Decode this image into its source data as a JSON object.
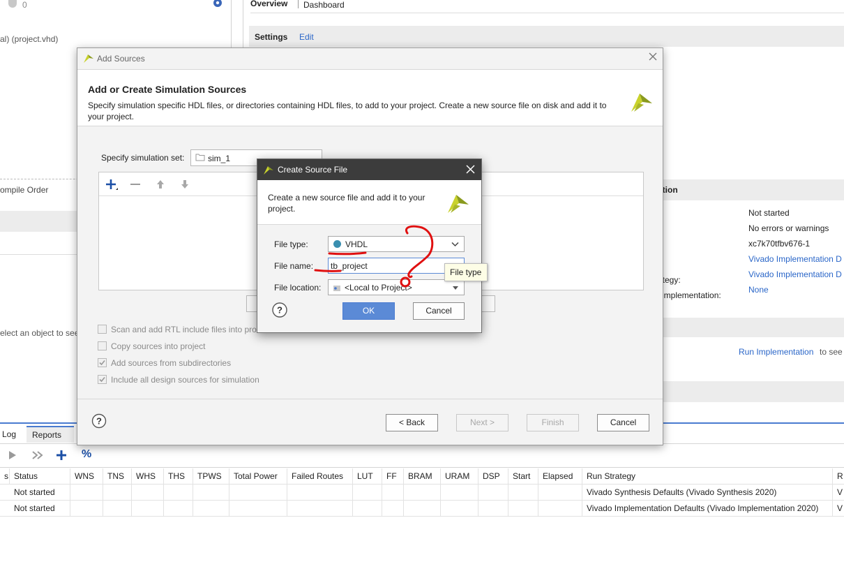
{
  "app": {
    "left": {
      "count": "0",
      "file_text": "al) (project.vhd)",
      "compile_order_tab": "ompile Order",
      "select_hint": "elect an object to see"
    },
    "right": {
      "tabs": [
        "Overview",
        "Dashboard"
      ],
      "settings_label": "Settings",
      "edit_link": "Edit",
      "section_header": "ation",
      "props": [
        {
          "label": "",
          "value": "Not started",
          "link": false
        },
        {
          "label": "",
          "value": "No errors or warnings",
          "link": false
        },
        {
          "label": "",
          "value": "xc7k70tfbv676-1",
          "link": false
        },
        {
          "label": "",
          "value": "Vivado Implementation D",
          "link": true
        },
        {
          "label": "ategy:",
          "value": "Vivado Implementation D",
          "link": true
        },
        {
          "label": "l implementation:",
          "value": "None",
          "link": true
        }
      ],
      "run_impl_link": "Run Implementation",
      "run_impl_suffix": "to see"
    },
    "bottom": {
      "tabs": [
        "Log",
        "Reports"
      ],
      "toolbar_percent": "%",
      "columns": [
        "s",
        "Status",
        "WNS",
        "TNS",
        "WHS",
        "THS",
        "TPWS",
        "Total Power",
        "Failed Routes",
        "LUT",
        "FF",
        "BRAM",
        "URAM",
        "DSP",
        "Start",
        "Elapsed",
        "Run Strategy",
        "R"
      ],
      "rows": [
        [
          "",
          "Not started",
          "",
          "",
          "",
          "",
          "",
          "",
          "",
          "",
          "",
          "",
          "",
          "",
          "",
          "",
          "Vivado Synthesis Defaults (Vivado Synthesis 2020)",
          "V"
        ],
        [
          "",
          "Not started",
          "",
          "",
          "",
          "",
          "",
          "",
          "",
          "",
          "",
          "",
          "",
          "",
          "",
          "",
          "Vivado Implementation Defaults (Vivado Implementation 2020)",
          "V"
        ]
      ]
    }
  },
  "add_sources": {
    "title": "Add Sources",
    "heading": "Add or Create Simulation Sources",
    "description": "Specify simulation specific HDL files, or directories containing HDL files, to add to your project. Create a new source file on disk and add it to your project.",
    "sim_set_label": "Specify simulation set:",
    "sim_set_value": "sim_1",
    "checkboxes": [
      {
        "label": "Scan and add RTL include files into pro",
        "checked": false
      },
      {
        "label": "Copy sources into project",
        "checked": false
      },
      {
        "label": "Add sources from subdirectories",
        "checked": true
      },
      {
        "label": "Include all design sources for simulation",
        "checked": true
      }
    ],
    "buttons": {
      "back": "< Back",
      "next": "Next >",
      "finish": "Finish",
      "cancel": "Cancel"
    }
  },
  "create_source": {
    "title": "Create Source File",
    "description": "Create a new source file and add it to your project.",
    "file_type_label": "File type:",
    "file_type_value": "VHDL",
    "file_name_label": "File name:",
    "file_name_value": "tb_project",
    "file_location_label": "File location:",
    "file_location_value": "<Local to Project>",
    "tooltip": "File type",
    "ok": "OK",
    "cancel": "Cancel"
  },
  "colors": {
    "accent_blue": "#4a7bd0",
    "ok_button": "#5b8ad6",
    "title_dark": "#3c3c3c",
    "vhdl_dot": "#3a8fb0",
    "annotation_red": "#e01010",
    "logo_yellow": "#c9d22c"
  }
}
